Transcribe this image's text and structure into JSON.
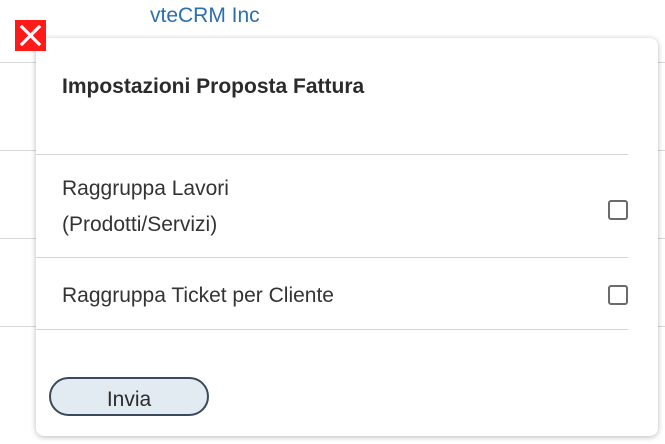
{
  "background": {
    "company_name": "vteCRM Inc"
  },
  "dialog": {
    "title": "Impostazioni Proposta Fattura",
    "close_icon": "close-x-icon",
    "options": [
      {
        "label": "Raggruppa Lavori (Prodotti/Servizi)",
        "checked": false
      },
      {
        "label": "Raggruppa Ticket per Cliente",
        "checked": false
      }
    ],
    "submit_label": "Invia"
  },
  "colors": {
    "close_button": "#ff1a1a",
    "link_blue": "#2a6fb0",
    "button_fill": "#e3ebf2"
  }
}
